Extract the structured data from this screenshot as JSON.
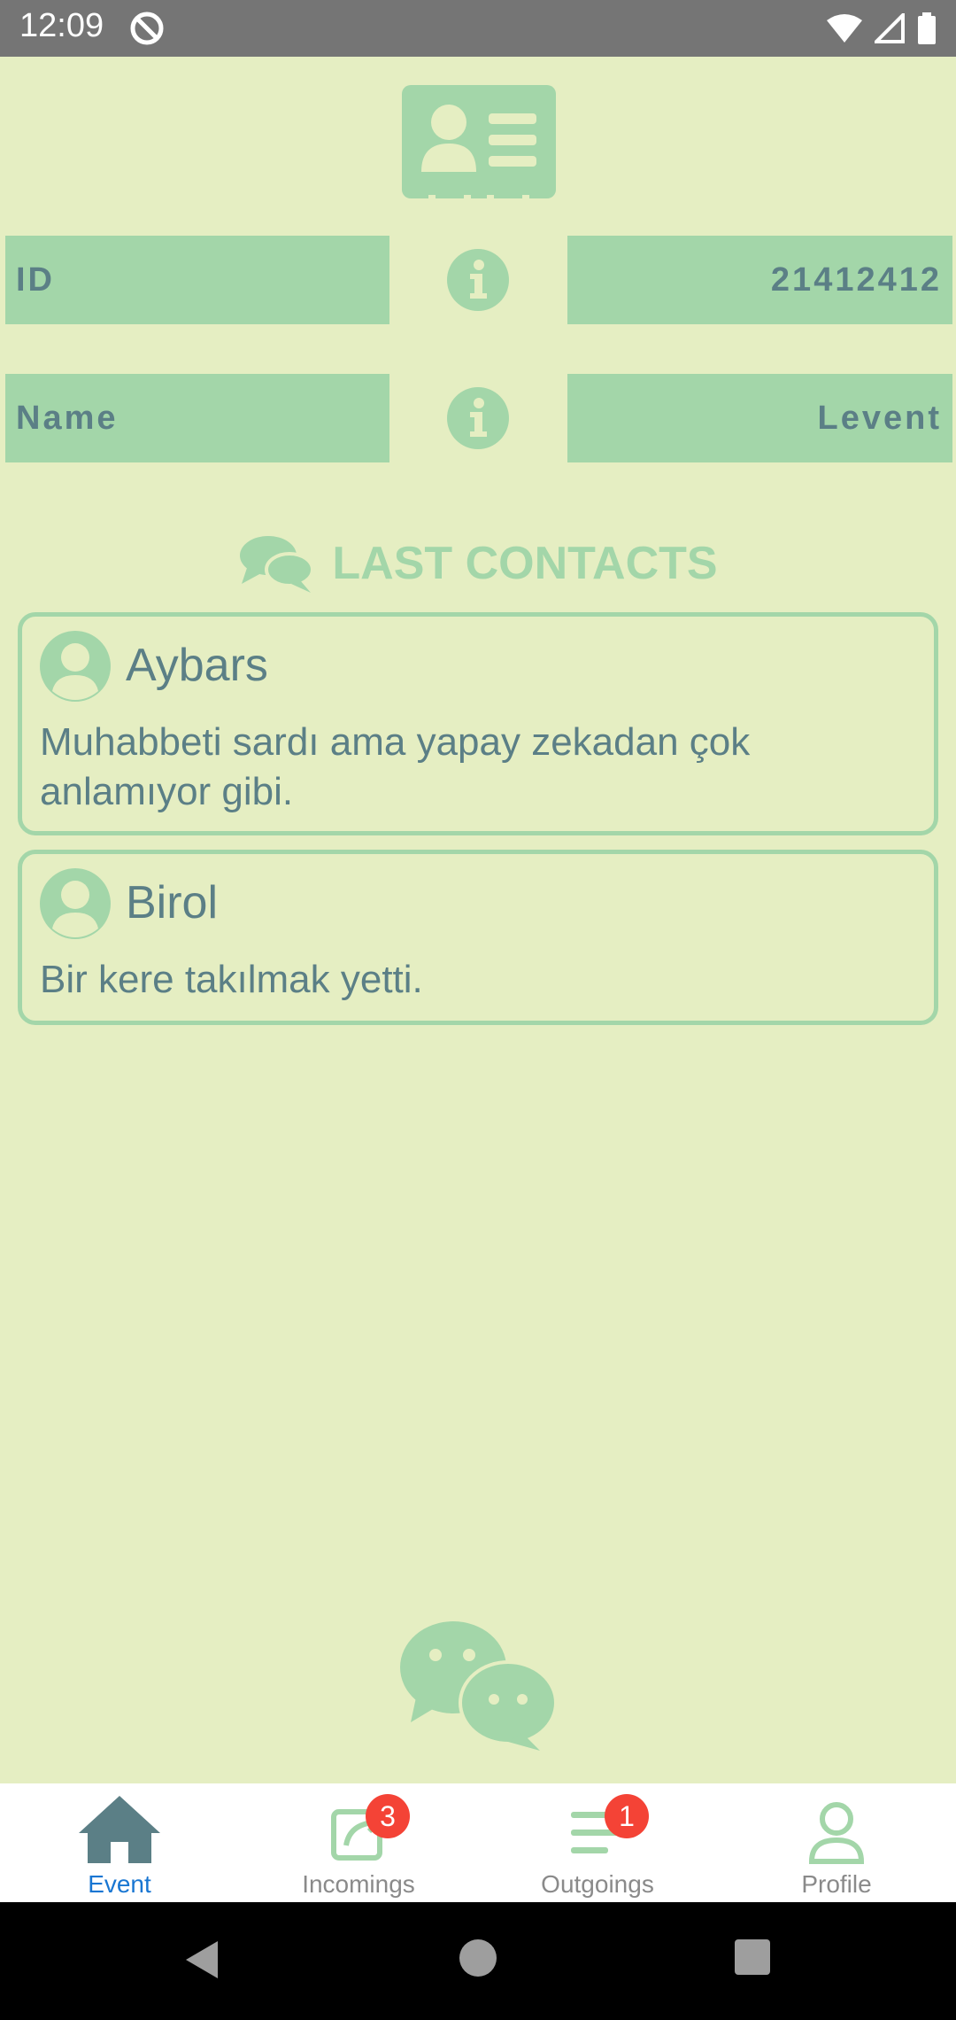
{
  "status_bar": {
    "time": "12:09"
  },
  "info_rows": [
    {
      "label": "ID",
      "value": "21412412"
    },
    {
      "label": "Name",
      "value": "Levent"
    }
  ],
  "contacts_section": {
    "title": "LAST CONTACTS"
  },
  "contacts": [
    {
      "name": "Aybars",
      "message": "Muhabbeti sardı ama yapay zekadan çok anlamıyor gibi."
    },
    {
      "name": "Birol",
      "message": "Bir kere takılmak yetti."
    }
  ],
  "bottom_nav": {
    "items": [
      {
        "label": "Event",
        "icon": "home-icon",
        "active": true
      },
      {
        "label": "Incomings",
        "icon": "inbox-icon",
        "badge": "3"
      },
      {
        "label": "Outgoings",
        "icon": "list-icon",
        "badge": "1"
      },
      {
        "label": "Profile",
        "icon": "person-icon"
      }
    ]
  },
  "colors": {
    "background": "#e5eec2",
    "accent": "#a3d6a9",
    "text": "#5b7f86",
    "active_nav": "#1976d2",
    "badge": "#f44336"
  }
}
